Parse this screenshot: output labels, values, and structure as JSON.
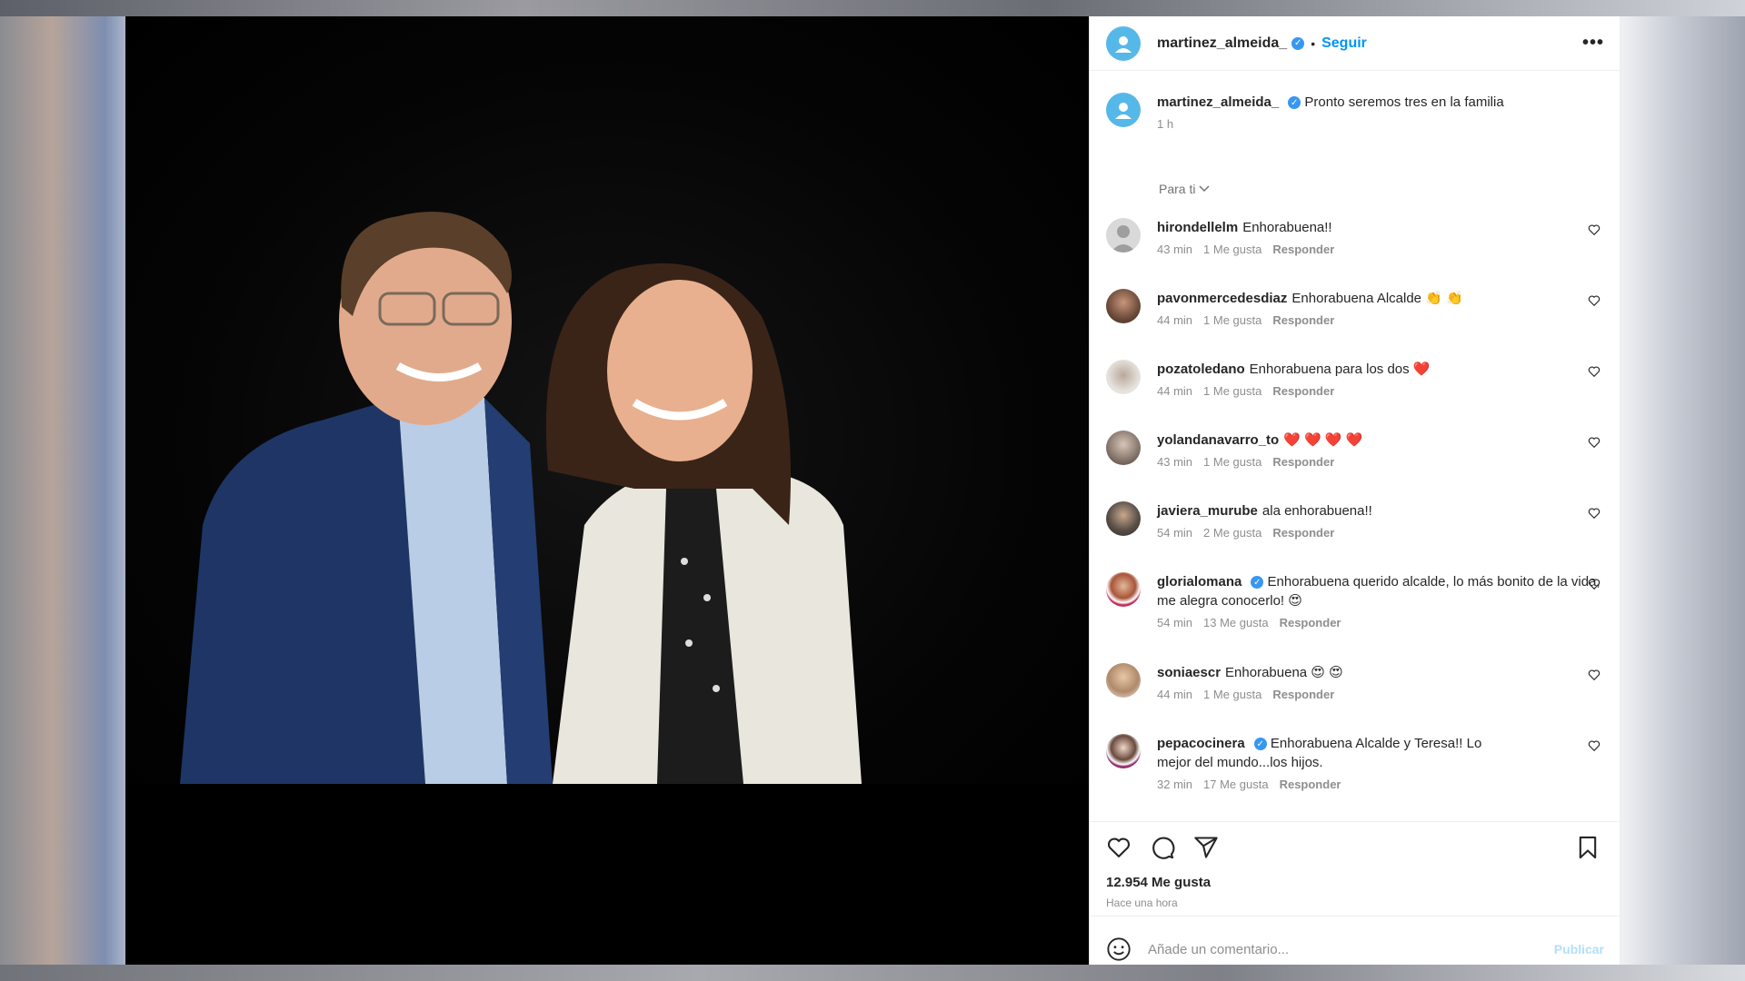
{
  "post": {
    "username": "martinez_almeida_",
    "verified_mark": "✓",
    "separator": "•",
    "follow_label": "Seguir",
    "more_label": "•••",
    "caption": "Pronto seremos tres en la familia",
    "caption_time": "1 h"
  },
  "filter": {
    "label": "Para ti"
  },
  "comments": [
    {
      "user": "hirondellelm",
      "text": "Enhorabuena!!",
      "time": "43 min",
      "likes": "1 Me gusta",
      "reply": "Responder",
      "avatar_color": "#c7c7c7",
      "verified": false
    },
    {
      "user": "pavonmercedesdiaz",
      "text": "Enhorabuena Alcalde 👏 👏",
      "time": "44 min",
      "likes": "1 Me gusta",
      "reply": "Responder",
      "avatar_color": "#6b4a3a",
      "verified": false
    },
    {
      "user": "pozatoledano",
      "text": "Enhorabuena para los dos ❤️",
      "time": "44 min",
      "likes": "1 Me gusta",
      "reply": "Responder",
      "avatar_color": "#d8d4cf",
      "verified": false
    },
    {
      "user": "yolandanavarro_to",
      "text": "❤️ ❤️ ❤️ ❤️",
      "time": "43 min",
      "likes": "1 Me gusta",
      "reply": "Responder",
      "avatar_color": "#9a8f88",
      "verified": false
    },
    {
      "user": "javiera_murube",
      "text": "ala enhorabuena!!",
      "time": "54 min",
      "likes": "2 Me gusta",
      "reply": "Responder",
      "avatar_color": "#5b5048",
      "verified": false
    },
    {
      "user": "glorialomana",
      "text": "Enhorabuena querido alcalde, lo más bonito de la vida, me alegra conocerlo! 😍",
      "time": "54 min",
      "likes": "13 Me gusta",
      "reply": "Responder",
      "avatar_color": "#c0392b",
      "verified": true
    },
    {
      "user": "soniaescr",
      "text": "Enhorabuena 😍 😍",
      "time": "44 min",
      "likes": "1 Me gusta",
      "reply": "Responder",
      "avatar_color": "#b08a6a",
      "verified": false
    },
    {
      "user": "pepacocinera",
      "text": "Enhorabuena Alcalde y Teresa!! Lo mejor del mundo...los hijos.",
      "time": "32 min",
      "likes": "17 Me gusta",
      "reply": "Responder",
      "avatar_color": "#8e2a6a",
      "verified": true
    }
  ],
  "actions": {
    "likes": "12.954 Me gusta",
    "posted": "Hace una hora"
  },
  "add_comment": {
    "placeholder": "Añade un comentario...",
    "publish_label": "Publicar"
  },
  "icons": [
    "like-icon",
    "comment-icon",
    "share-icon",
    "bookmark-icon",
    "emoji-icon",
    "heart-small-icon",
    "chevron-down-icon"
  ],
  "colors": {
    "accent": "#0095f6",
    "verified": "#3897f0",
    "avatar": "#56b8e8"
  }
}
